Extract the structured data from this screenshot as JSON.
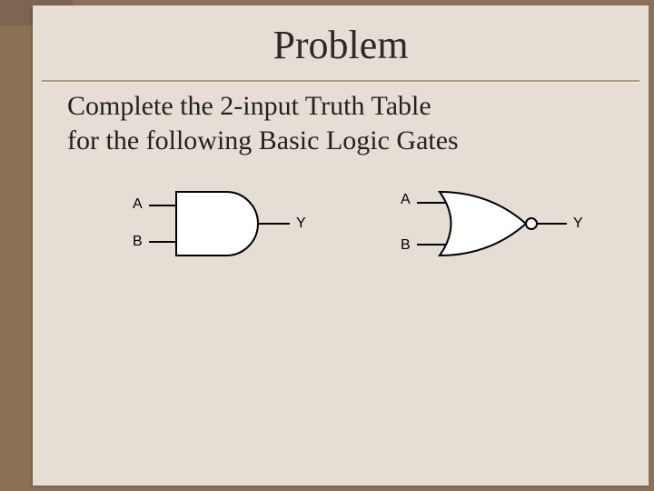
{
  "title": "Problem",
  "instruction_line1": "Complete the 2-input Truth Table",
  "instruction_line2": "for the following Basic Logic Gates",
  "gates": {
    "left": {
      "type": "AND",
      "inputs": {
        "top": "A",
        "bottom": "B"
      },
      "output": "Y"
    },
    "right": {
      "type": "NOR",
      "inputs": {
        "top": "A",
        "bottom": "B"
      },
      "output": "Y"
    }
  }
}
